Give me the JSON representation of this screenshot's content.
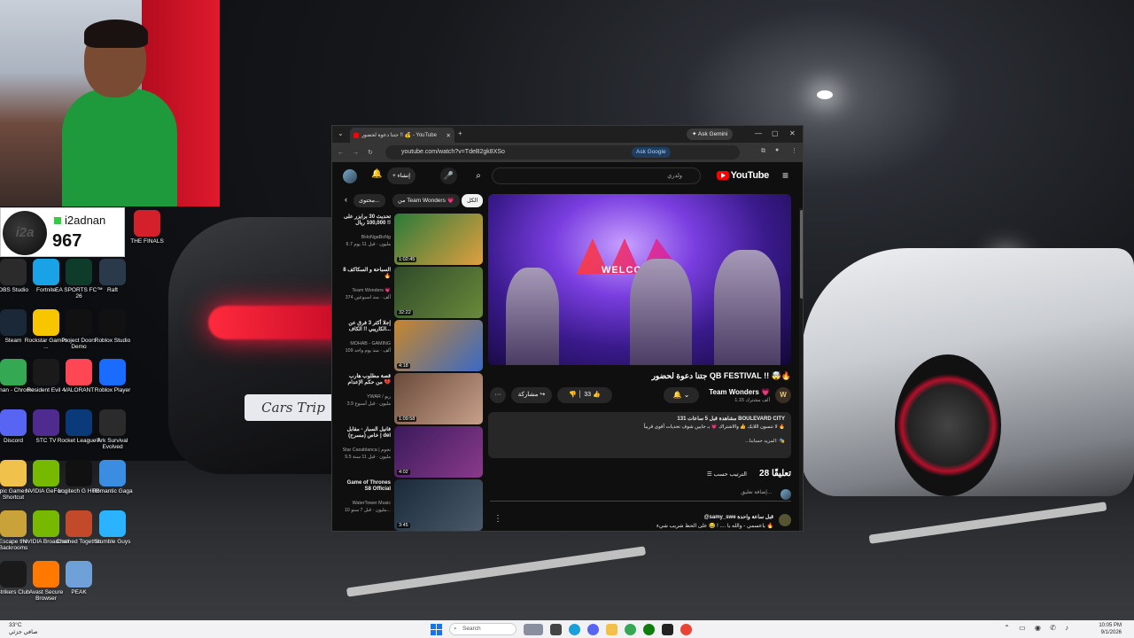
{
  "streamer": {
    "name": "i2adnan",
    "count": "967",
    "avatar_text": "i2a"
  },
  "desktop_icons": [
    {
      "label": "THE FINALS",
      "icon": "the-finals-icon",
      "color": "#d3202a"
    },
    {
      "label": "OBS Studio",
      "icon": "obs-icon",
      "color": "#2b2b2b"
    },
    {
      "label": "Fortnite",
      "icon": "fortnite-icon",
      "color": "#1aa2e6"
    },
    {
      "label": "EA SPORTS FC™ 26",
      "icon": "ea-fc-icon",
      "color": "#0e3b2a"
    },
    {
      "label": "Raft",
      "icon": "raft-icon",
      "color": "#2a3a4a"
    },
    {
      "label": "Steam",
      "icon": "steam-icon",
      "color": "#1b2838"
    },
    {
      "label": "Rockstar Games ...",
      "icon": "rockstar-icon",
      "color": "#f7c600"
    },
    {
      "label": "Project Doors Demo",
      "icon": "doors-icon",
      "color": "#111111"
    },
    {
      "label": "Roblox Studio",
      "icon": "roblox-studio-icon",
      "color": "#111111"
    },
    {
      "label": "Adnan - Chrome",
      "icon": "chrome-icon",
      "color": "#34a853"
    },
    {
      "label": "Resident Evil 4",
      "icon": "resident-evil-icon",
      "color": "#1a1a1a"
    },
    {
      "label": "VALORANT",
      "icon": "valorant-icon",
      "color": "#ff4655"
    },
    {
      "label": "Roblox Player",
      "icon": "roblox-player-icon",
      "color": "#1a6bff"
    },
    {
      "label": "Discord",
      "icon": "discord-icon",
      "color": "#5865f2"
    },
    {
      "label": "STC TV",
      "icon": "stc-tv-icon",
      "color": "#4f2a8f"
    },
    {
      "label": "Rocket League®",
      "icon": "rocket-league-icon",
      "color": "#0a3a7a"
    },
    {
      "label": "Ark Survival Evolved",
      "icon": "ark-icon",
      "color": "#2b2b2b"
    },
    {
      "label": "Epic Games - Shortcut",
      "icon": "folder-icon",
      "color": "#f0c24b"
    },
    {
      "label": "NVIDIA GeFor...",
      "icon": "nvidia-icon",
      "color": "#76b900"
    },
    {
      "label": "Logitech G HUB",
      "icon": "logitech-icon",
      "color": "#111111"
    },
    {
      "label": "Romantic Gaga",
      "icon": "romantic-gaga-icon",
      "color": "#3a8de0"
    },
    {
      "label": "Escape the Backrooms",
      "icon": "backrooms-icon",
      "color": "#c9a23a"
    },
    {
      "label": "NVIDIA Broadcast",
      "icon": "nvidia-broadcast-icon",
      "color": "#76b900"
    },
    {
      "label": "Chained Together",
      "icon": "chained-icon",
      "color": "#c24a2a"
    },
    {
      "label": "Stumble Guys",
      "icon": "stumble-guys-icon",
      "color": "#2bb3ff"
    },
    {
      "label": "Strikers Club",
      "icon": "strikers-icon",
      "color": "#1a1a1a"
    },
    {
      "label": "Avast Secure Browser",
      "icon": "avast-icon",
      "color": "#ff7800"
    },
    {
      "label": "PEAK",
      "icon": "peak-icon",
      "color": "#6fa0d8"
    }
  ],
  "browser": {
    "tab_title": "جتنا دعوة لحضور !! 💰 - YouTube",
    "new_tab": "+",
    "gemini": "Ask Gemini",
    "url": "youtube.com/watch?v=TdeB2gk8XSo",
    "ask_google": "Ask Google"
  },
  "youtube": {
    "logo": "YouTube",
    "search_value": "ولدري",
    "create_label": "إنشاء",
    "chips": [
      "الكل",
      "من Team Wonders 💗",
      "محتوى..."
    ],
    "related": [
      {
        "title": "تحديث 30 برايزر على 100,000 ريال !!",
        "channel": "BHoNgaBoNg",
        "meta": "6.7 مليون · قبل 11 يوم",
        "duration": "1:02:45",
        "colors": [
          "#2a7a3a",
          "#e0a040"
        ]
      },
      {
        "title": "السباحة و السكاكف 8 🔥",
        "channel": "Team Wonders 💗",
        "meta": "374 ألف · منذ اسبوعين",
        "duration": "32:22",
        "colors": [
          "#2e4a2a",
          "#6a8a3a"
        ]
      },
      {
        "title": "إجلا أكثر 3 فرق عن الكاريبي !! الكاف...",
        "channel": "MOHAB - GAMING",
        "meta": "109 ألف · منذ يوم واحد",
        "duration": "4:18",
        "colors": [
          "#c8872a",
          "#3a6ac4"
        ]
      },
      {
        "title": "قصة مطلوب هارب من حكم الإعدام 💔",
        "channel": "YWAR / ريو",
        "meta": "3.9 مليون · قبل أسبوع",
        "duration": "1:09:58",
        "colors": [
          "#6a4a3a",
          "#c8a08a"
        ]
      },
      {
        "title": "فانيل السبار - مقابل خاص (مسرح) | del",
        "channel": "Star Casablanca | نجوم",
        "meta": "9.5 مليون · قبل 11 سنة",
        "duration": "4:02",
        "colors": [
          "#3a1a5a",
          "#8a3a8a"
        ]
      },
      {
        "title": "Game of Thrones S8 Official",
        "channel": "WaterTower Music",
        "meta": "10 مليون · قبل 7 سنو...",
        "duration": "3:45",
        "colors": [
          "#1a2a3a",
          "#4a5a6a"
        ]
      }
    ],
    "video_title": "جتنا دعوة لحضور QB FESTIVAL !! 🤯🔥",
    "channel_name": "Team Wonders 💗",
    "channel_subs": "1.15 ألف مشترك",
    "subscribe_label": "🔔 ⌄",
    "likes": "33",
    "share_label": "مشاركة",
    "more_label": "···",
    "desc_meta": "131 مشاهدة قبل 5 ساعات  BOULEVARD CITY",
    "desc_body": "لا تنسون اللايك 👍 والاشتراك 💗 بـ جايين شوف تحديات أقوى قريباً 🔥",
    "desc_more": "...المزيد    حسابنا: 🎭",
    "comments_count": "28 تعليقًا",
    "sort_label": "الترتيب حسب",
    "add_comment_placeholder": "إضافة تعليق...",
    "comment_author": "@samy_swe قبل ساعة واحدة",
    "comment_text": "ياعسمي - والله يا .... ! 😂 على الحظ شريب شيء 🔥"
  },
  "taskbar": {
    "weather_temp": "33°C",
    "weather_desc": "صافي جزئي",
    "search_label": "Search",
    "time": "10:05 PM",
    "date": "9/1/2026"
  }
}
